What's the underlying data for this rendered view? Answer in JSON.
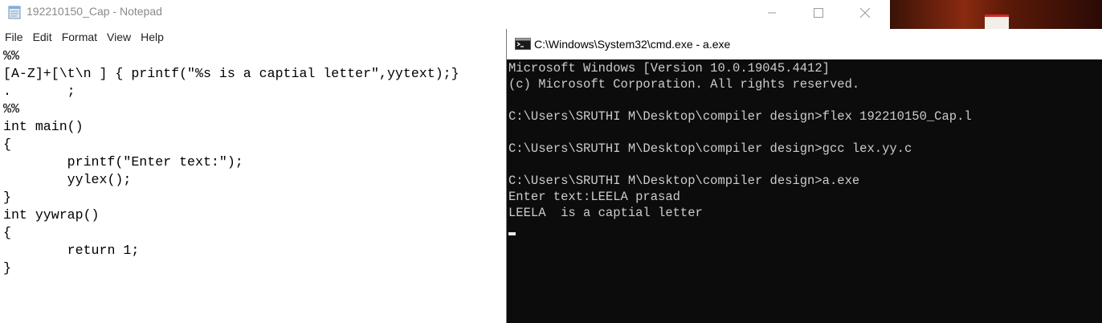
{
  "notepad": {
    "title": "192210150_Cap - Notepad",
    "menu": [
      "File",
      "Edit",
      "Format",
      "View",
      "Help"
    ],
    "content": "%%\n[A-Z]+[\\t\\n ] { printf(\"%s is a captial letter\",yytext);}\n.\t;\n%%\nint main()\n{\n\tprintf(\"Enter text:\");\n\tyylex();\n}\nint yywrap()\n{\n\treturn 1;\n}"
  },
  "cmd": {
    "title": "C:\\Windows\\System32\\cmd.exe - a.exe",
    "lines": [
      "Microsoft Windows [Version 10.0.19045.4412]",
      "(c) Microsoft Corporation. All rights reserved.",
      "",
      "C:\\Users\\SRUTHI M\\Desktop\\compiler design>flex 192210150_Cap.l",
      "",
      "C:\\Users\\SRUTHI M\\Desktop\\compiler design>gcc lex.yy.c",
      "",
      "C:\\Users\\SRUTHI M\\Desktop\\compiler design>a.exe",
      "Enter text:LEELA prasad",
      "LEELA  is a captial letter"
    ]
  },
  "icons": {
    "notepad_app": "notepad-icon",
    "minimize": "minimize-icon",
    "maximize": "maximize-icon",
    "close": "close-icon",
    "cmd_app": "cmd-icon"
  },
  "colors": {
    "console_bg": "#0c0c0c",
    "console_text": "#cccccc",
    "title_inactive": "#8a8a8a"
  }
}
